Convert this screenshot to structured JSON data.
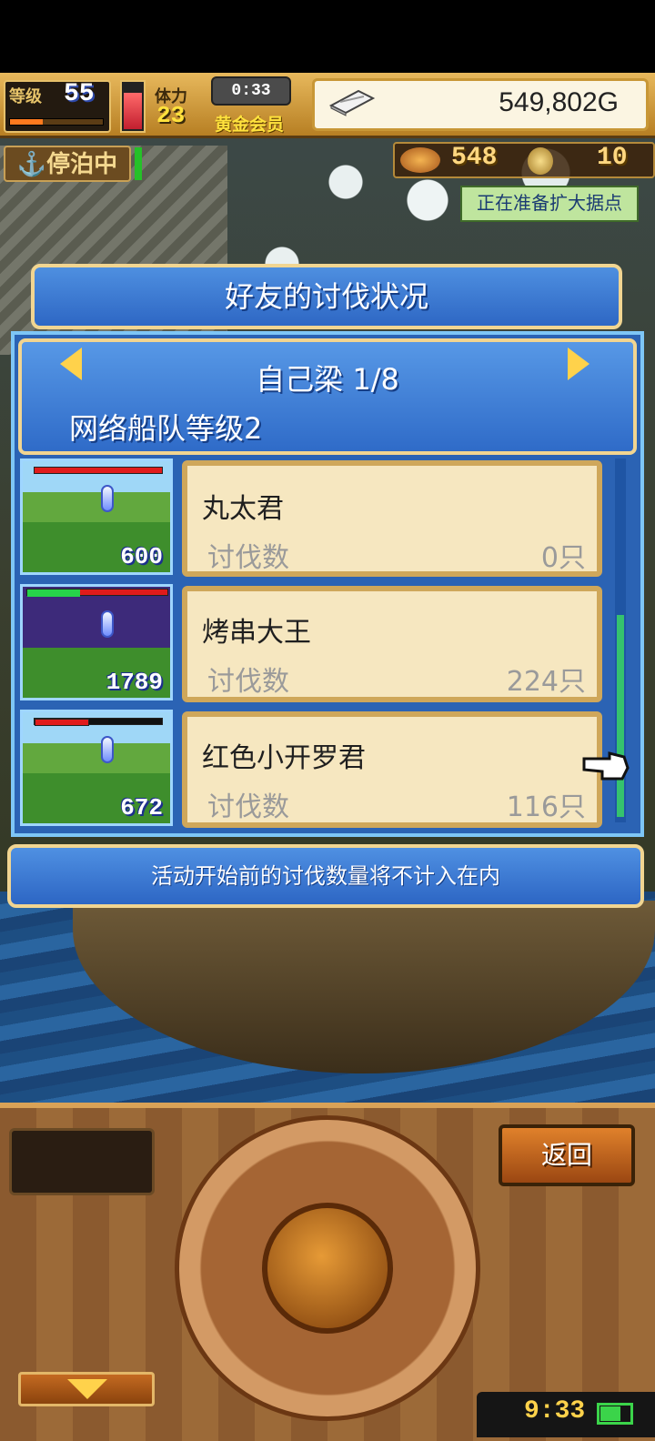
{
  "status": {
    "level_label": "等级",
    "level": "55",
    "level_progress": 0.35,
    "stamina_label": "体力",
    "stamina": "23",
    "timer": "0:33",
    "membership": "黄金会员",
    "money": "549,802G",
    "dock_status": "停泊中",
    "resource_1": "548",
    "resource_2": "10",
    "notice": "正在准备扩大据点"
  },
  "dialog": {
    "title": "好友的讨伐状况",
    "friend_name": "自己梁 1/8",
    "fleet_level": "网络船队等级2",
    "rows": [
      {
        "name": "丸太君",
        "label": "讨伐数",
        "value": "0只",
        "count": "600"
      },
      {
        "name": "烤串大王",
        "label": "讨伐数",
        "value": "224只",
        "count": "1789"
      },
      {
        "name": "红色小开罗君",
        "label": "讨伐数",
        "value": "116只",
        "count": "672"
      }
    ],
    "note": "活动开始前的讨伐数量将不计入在内"
  },
  "controls": {
    "back": "返回",
    "clock": "9:33"
  },
  "colors": {
    "panel_blue": "#2b63b4",
    "card": "#f6e7c0",
    "accent_gold": "#f1d591"
  }
}
